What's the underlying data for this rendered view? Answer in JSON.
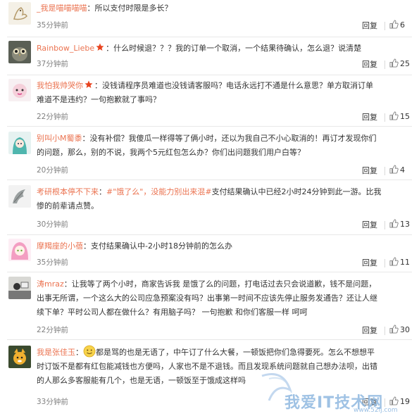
{
  "labels": {
    "reply": "回复"
  },
  "colors": {
    "username": "#eb7350",
    "divider": "#e8e8e8",
    "watermark": "#8fb8e0"
  },
  "comments": [
    {
      "user": "_我是喵喵喵喵",
      "separator": "：",
      "text": "所以支付时限是多长？",
      "time": "35分钟前",
      "likes": "6",
      "avatar_icon": "bird-sketch-icon"
    },
    {
      "user": "Rainbow_Liebe",
      "vip_icon": "vip-star-icon",
      "separator": "：",
      "text": "什么时候退？？？我的订单一个取消，一个结果待确认，怎么退？说清楚",
      "time": "37分钟前",
      "likes": "25",
      "avatar_icon": "owl-photo-icon"
    },
    {
      "user": "我怕我帅哭你",
      "vip_icon": "vip-star-icon",
      "separator": "：",
      "text_line1": "没钱请程序员难道也没钱请客服吗？电话永远打不通是什么意思？单方取消订单",
      "text_line2": "难道不是违约？一句抱歉就了事吗？",
      "time": "22分钟前",
      "likes": "15",
      "avatar_icon": "pink-cartoon-icon"
    },
    {
      "user": "别叫小M蜀黍",
      "separator": "：",
      "text_line1": "没有补偿？我傻瓜一样得等了俩小时，还以为我自己不小心取消的！再订才发现你们",
      "text_line2": "的问题，那么，别的不说，我两个5元红包怎么办？你们出问题我们用户白等？",
      "time": "20分钟前",
      "likes": "4",
      "avatar_icon": "teal-character-icon"
    },
    {
      "user": "考研根本停不下来",
      "separator": "：",
      "mention": "#\"饿了么\"，没能力别出来混#",
      "text_line1_rest": "支付结果确认中已经2小时24分钟到此一游。比我",
      "text_line2": "惨的前辈请点赞。",
      "time": "30分钟前",
      "likes": "13",
      "avatar_icon": "feather-bird-icon"
    },
    {
      "user": "摩羯座的小蓓",
      "separator": "：",
      "text": "支付结果确认中-2小时18分钟前的怎么办",
      "time": "35分钟前",
      "likes": "11",
      "avatar_icon": "anime-girl-icon"
    },
    {
      "user": "涛mraz",
      "separator": "：",
      "text_line1": "让我等了两个小时，商家告诉我 是饿了么的问题，打电话过去只会说道歉，钱不是问题，",
      "text_line2": "出事无所谓，一个这么大的公司应急预案没有吗？出事第一时间不应该先停止服务发通告？还让人继",
      "text_line3": "续下单？平时公司人都在做什么？有用脑子吗？ 一句抱歉 和你们客服一样 呵呵",
      "time": "22分钟前",
      "likes": "30",
      "avatar_icon": "office-scene-icon"
    },
    {
      "user": "我是张佳玉",
      "separator": "：",
      "emoji_icon": "smile-emoji-icon",
      "text_line1": "都是骂的也是无语了，中午订了什么大餐，一顿饭把你们急得要死。怎么不想想平",
      "text_line2": "时订饭不是都有红包能减钱也方便吗，人家也不是不退钱。而且发现系统问题就自己想办法呗，出错",
      "text_line3": "的人那么多客服能有几个，也是无语，一顿饭至于饿成这样吗",
      "time": "33分钟前",
      "likes": "19",
      "avatar_icon": "cartoon-fox-icon"
    }
  ],
  "watermark": {
    "text": "我爱IT技术网",
    "url": "www.52ij.com"
  }
}
